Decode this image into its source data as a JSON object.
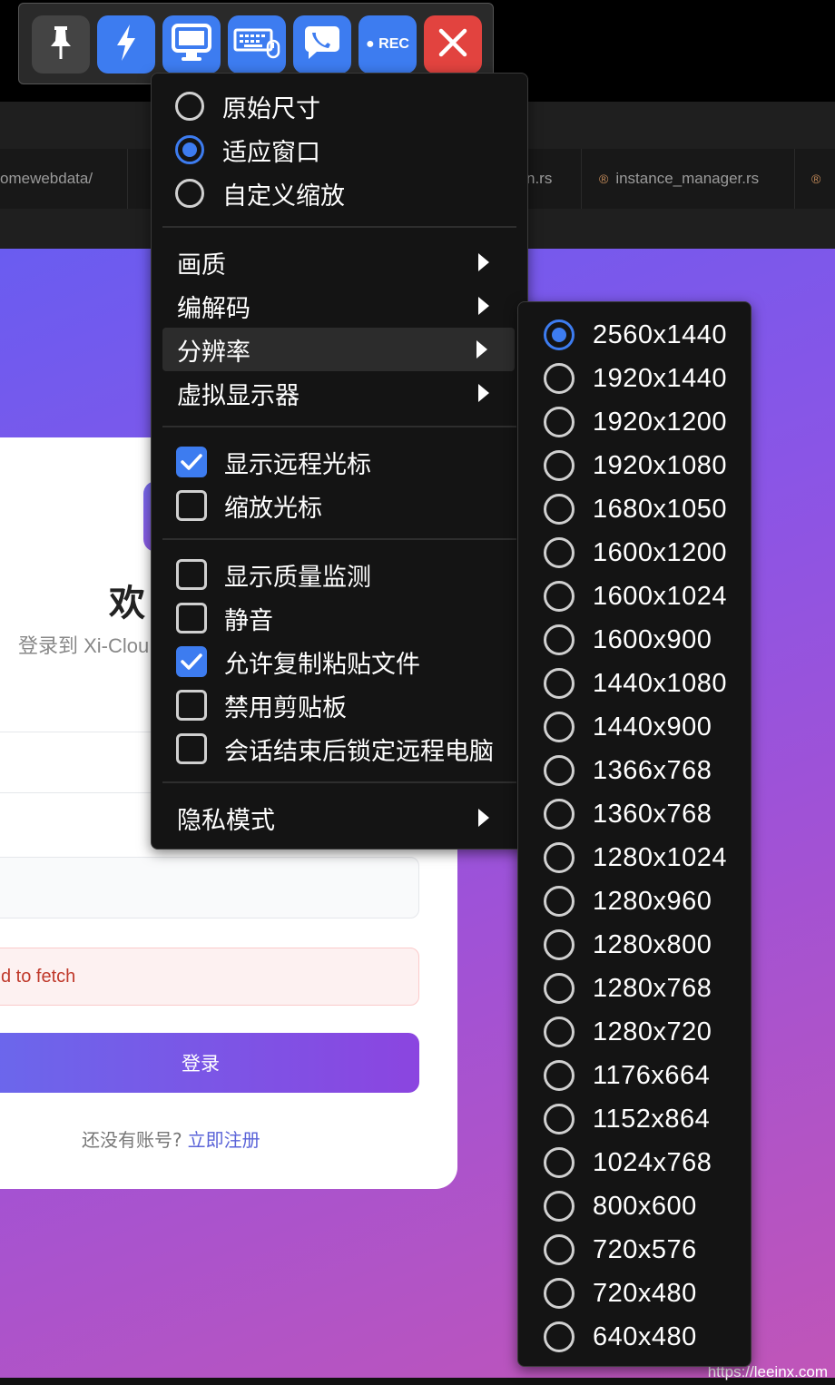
{
  "toolbar": {
    "buttons": [
      {
        "name": "pin-icon",
        "color": "#444444"
      },
      {
        "name": "lightning-icon",
        "color": "#3d7cf0"
      },
      {
        "name": "monitor-icon",
        "color": "#3d7cf0"
      },
      {
        "name": "keyboard-icon",
        "color": "#3d7cf0"
      },
      {
        "name": "chat-icon",
        "color": "#3d7cf0"
      },
      {
        "name": "record-button",
        "label": "REC",
        "color": "#3d7cf0"
      },
      {
        "name": "close-icon",
        "color": "#e2433f"
      }
    ]
  },
  "view_menu": {
    "scale_options": [
      {
        "label": "原始尺寸",
        "selected": false
      },
      {
        "label": "适应窗口",
        "selected": true
      },
      {
        "label": "自定义缩放",
        "selected": false
      }
    ],
    "submenus": [
      "画质",
      "编解码",
      "分辨率",
      "虚拟显示器"
    ],
    "highlighted_submenu": "分辨率",
    "cursor_options": [
      {
        "label": "显示远程光标",
        "checked": true
      },
      {
        "label": "缩放光标",
        "checked": false
      }
    ],
    "session_options": [
      {
        "label": "显示质量监测",
        "checked": false
      },
      {
        "label": "静音",
        "checked": false
      },
      {
        "label": "允许复制粘贴文件",
        "checked": true
      },
      {
        "label": "禁用剪贴板",
        "checked": false
      },
      {
        "label": "会话结束后锁定远程电脑",
        "checked": false
      }
    ],
    "privacy": "隐私模式"
  },
  "resolution_menu": {
    "selected": "2560x1440",
    "options": [
      "2560x1440",
      "1920x1440",
      "1920x1200",
      "1920x1080",
      "1680x1050",
      "1600x1200",
      "1600x1024",
      "1600x900",
      "1440x1080",
      "1440x900",
      "1366x768",
      "1360x768",
      "1280x1024",
      "1280x960",
      "1280x800",
      "1280x768",
      "1280x720",
      "1176x664",
      "1152x864",
      "1024x768",
      "800x600",
      "720x576",
      "720x480",
      "640x480"
    ]
  },
  "remote_screen": {
    "tabs": [
      "omewebdata/",
      "n.rs",
      "instance_manager.rs"
    ],
    "welcome": "欢",
    "subtitle": "登录到 Xi-Clou",
    "error_text": "d to fetch",
    "login_button": "登录",
    "register_prompt": "还没有账号?",
    "register_link": "立即注册",
    "watermark": "https://leeinx.com"
  },
  "colors": {
    "accent": "#3d7cf0",
    "danger": "#e2433f",
    "menu_bg": "#141414"
  }
}
